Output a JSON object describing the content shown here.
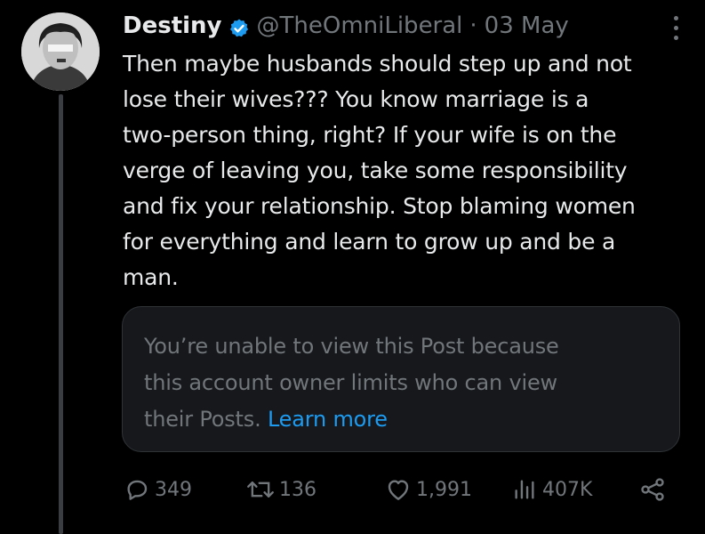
{
  "tweet": {
    "author": {
      "display_name": "Destiny",
      "handle": "@TheOmniLiberal",
      "verified": true
    },
    "separator": "·",
    "date": "03 May",
    "text_lines": [
      "Then maybe husbands should step up and not",
      "lose their wives??? You know marriage is a",
      "two-person thing, right? If your wife is on the",
      "verge of leaving you, take some responsibility",
      "and fix your relationship. Stop blaming women",
      "for everything and learn to grow up and be a",
      "man."
    ],
    "quoted_post": {
      "lines": [
        "You’re unable to view this Post because",
        "this account owner limits who can view",
        "their Posts."
      ],
      "link_text": "Learn more"
    },
    "stats": {
      "replies": "349",
      "reposts": "136",
      "likes": "1,991",
      "views": "407K"
    }
  },
  "colors": {
    "background": "#000000",
    "text": "#e7e9ea",
    "muted": "#71767b",
    "link": "#1d9bf0",
    "verified_badge": "#1d9bf0"
  },
  "icons": [
    "more-icon",
    "verified-badge-icon",
    "reply-icon",
    "repost-icon",
    "like-icon",
    "views-icon",
    "share-icon"
  ]
}
